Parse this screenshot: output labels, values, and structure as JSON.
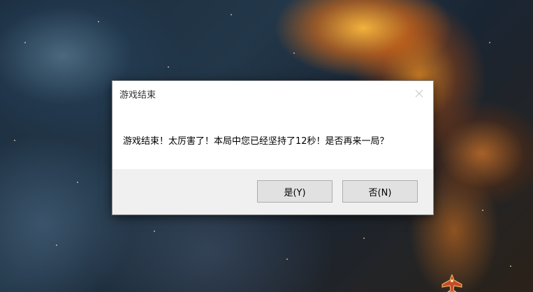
{
  "dialog": {
    "title": "游戏结束",
    "message": "游戏结束！太厉害了！本局中您已经坚持了12秒！是否再来一局？",
    "buttons": {
      "yes_label": "是(Y)",
      "no_label": "否(N)"
    },
    "close_icon": "close-icon"
  },
  "colors": {
    "dialog_bg": "#ffffff",
    "button_area_bg": "#f0f0f0",
    "button_bg": "#e1e1e1",
    "button_border": "#adadad"
  }
}
